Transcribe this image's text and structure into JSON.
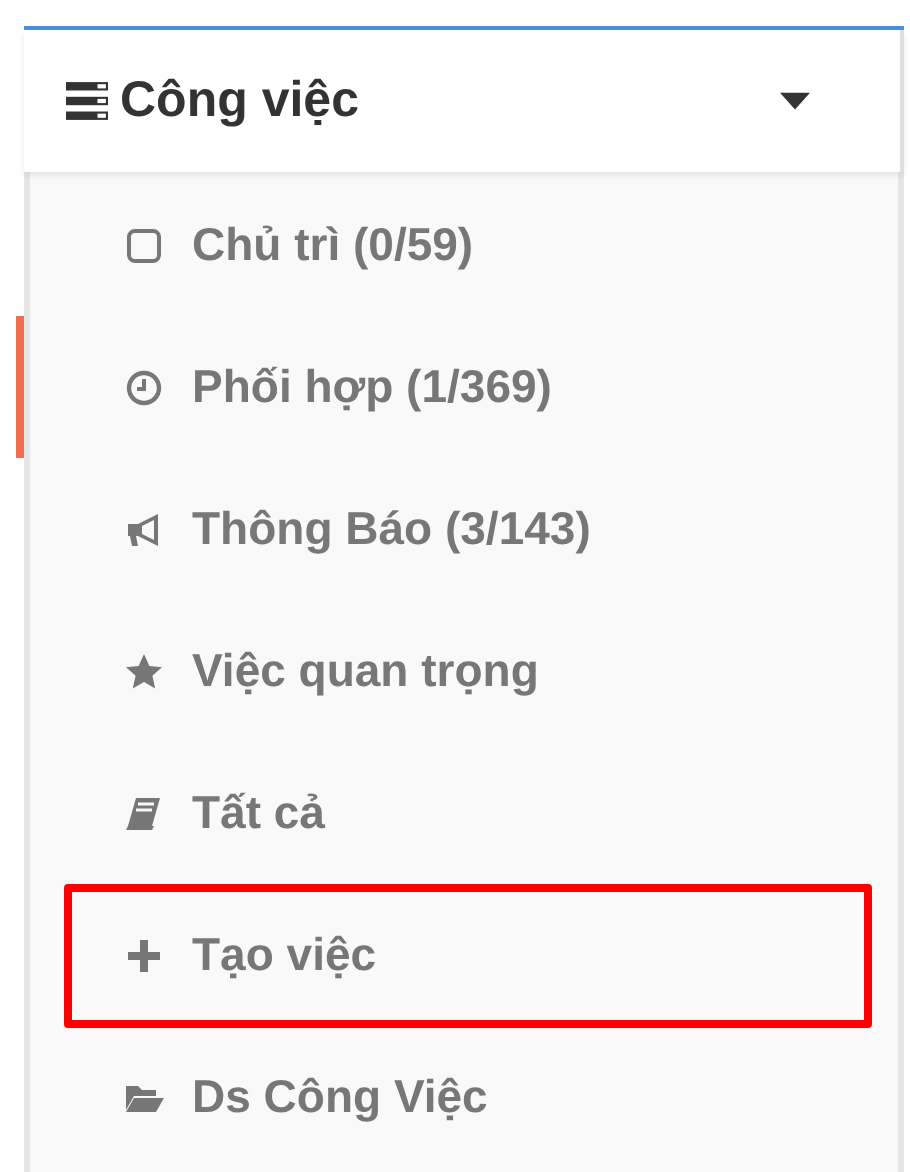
{
  "menu": {
    "title": "Công việc",
    "expanded": true,
    "items": [
      {
        "kind": "checkbox",
        "label": "Chủ trì (0/59)",
        "selected": false,
        "highlighted": false
      },
      {
        "kind": "clock",
        "label": "Phối hợp (1/369)",
        "selected": true,
        "highlighted": false
      },
      {
        "kind": "bullhorn",
        "label": "Thông Báo (3/143)",
        "selected": false,
        "highlighted": false
      },
      {
        "kind": "star",
        "label": "Việc quan trọng",
        "selected": false,
        "highlighted": false
      },
      {
        "kind": "book",
        "label": "Tất cả",
        "selected": false,
        "highlighted": false
      },
      {
        "kind": "plus",
        "label": "Tạo việc",
        "selected": false,
        "highlighted": true
      },
      {
        "kind": "folder",
        "label": "Ds Công Việc",
        "selected": false,
        "highlighted": false
      }
    ]
  }
}
